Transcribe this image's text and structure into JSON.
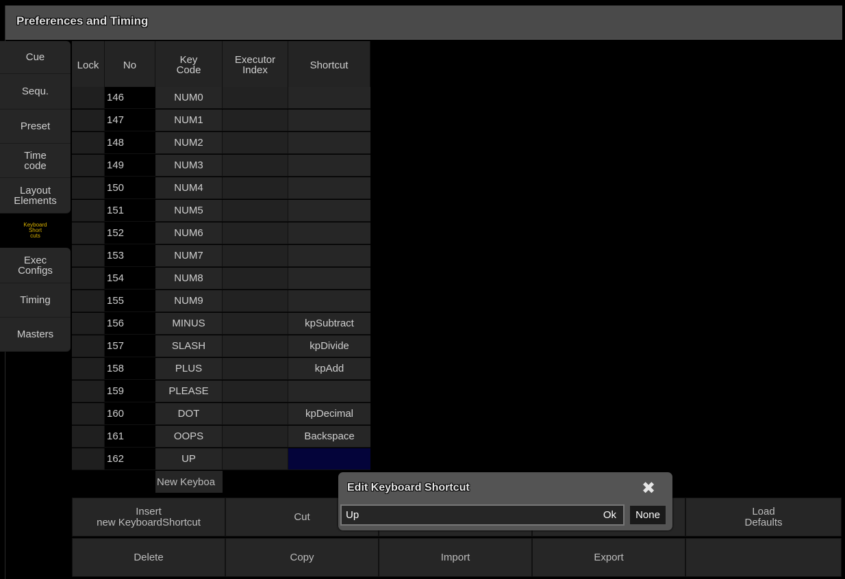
{
  "window": {
    "title": "Preferences and Timing"
  },
  "sidebar": {
    "items": [
      {
        "label": "Cue"
      },
      {
        "label": "Sequ."
      },
      {
        "label": "Preset"
      },
      {
        "label": "Time\ncode"
      },
      {
        "label": "Layout\nElements"
      },
      {
        "label": "Keyboard\nShort\ncuts"
      },
      {
        "label": "Exec\nConfigs"
      },
      {
        "label": "Timing"
      },
      {
        "label": "Masters"
      }
    ]
  },
  "table": {
    "headers": {
      "lock": "Lock",
      "no": "No",
      "key_code": "Key\nCode",
      "executor_index": "Executor\nIndex",
      "shortcut": "Shortcut"
    },
    "rows": [
      {
        "no": "146",
        "key": "NUM0",
        "shortcut": ""
      },
      {
        "no": "147",
        "key": "NUM1",
        "shortcut": ""
      },
      {
        "no": "148",
        "key": "NUM2",
        "shortcut": ""
      },
      {
        "no": "149",
        "key": "NUM3",
        "shortcut": ""
      },
      {
        "no": "150",
        "key": "NUM4",
        "shortcut": ""
      },
      {
        "no": "151",
        "key": "NUM5",
        "shortcut": ""
      },
      {
        "no": "152",
        "key": "NUM6",
        "shortcut": ""
      },
      {
        "no": "153",
        "key": "NUM7",
        "shortcut": ""
      },
      {
        "no": "154",
        "key": "NUM8",
        "shortcut": ""
      },
      {
        "no": "155",
        "key": "NUM9",
        "shortcut": ""
      },
      {
        "no": "156",
        "key": "MINUS",
        "shortcut": "kpSubtract"
      },
      {
        "no": "157",
        "key": "SLASH",
        "shortcut": "kpDivide"
      },
      {
        "no": "158",
        "key": "PLUS",
        "shortcut": "kpAdd"
      },
      {
        "no": "159",
        "key": "PLEASE",
        "shortcut": ""
      },
      {
        "no": "160",
        "key": "DOT",
        "shortcut": "kpDecimal"
      },
      {
        "no": "161",
        "key": "OOPS",
        "shortcut": "Backspace"
      },
      {
        "no": "162",
        "key": "UP",
        "shortcut": ""
      }
    ],
    "new_row_label": "New Keyboa"
  },
  "buttons": {
    "insert": "Insert\nnew KeyboardShortcut",
    "cut": "Cut",
    "load_defaults": "Load\nDefaults",
    "delete": "Delete",
    "copy": "Copy",
    "import": "Import",
    "export": "Export"
  },
  "dialog": {
    "title": "Edit Keyboard Shortcut",
    "value": "Up",
    "ok": "Ok",
    "none": "None",
    "close_icon": "close-icon"
  },
  "colors": {
    "accent_active_tab": "#d8b100",
    "selected_cell": "#04043a"
  }
}
